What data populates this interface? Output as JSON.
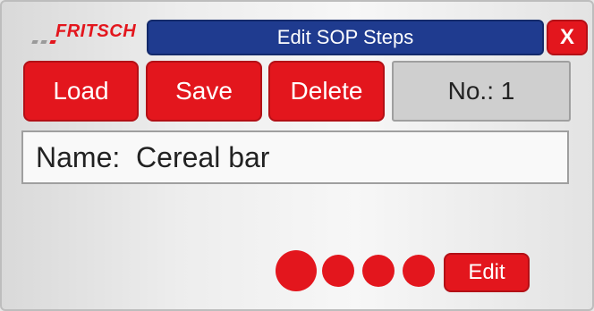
{
  "brand": {
    "logo_text": "FRITSCH",
    "accent_color": "#e3161d"
  },
  "header": {
    "title": "Edit SOP Steps",
    "close_label": "X",
    "title_bar_color": "#1f3b8f"
  },
  "toolbar": {
    "load_label": "Load",
    "save_label": "Save",
    "delete_label": "Delete",
    "number_display": "No.: 1"
  },
  "sop": {
    "name_display": "Name:  Cereal bar"
  },
  "pager": {
    "dot_count": 4,
    "active_index": 0
  },
  "actions": {
    "edit_label": "Edit"
  }
}
